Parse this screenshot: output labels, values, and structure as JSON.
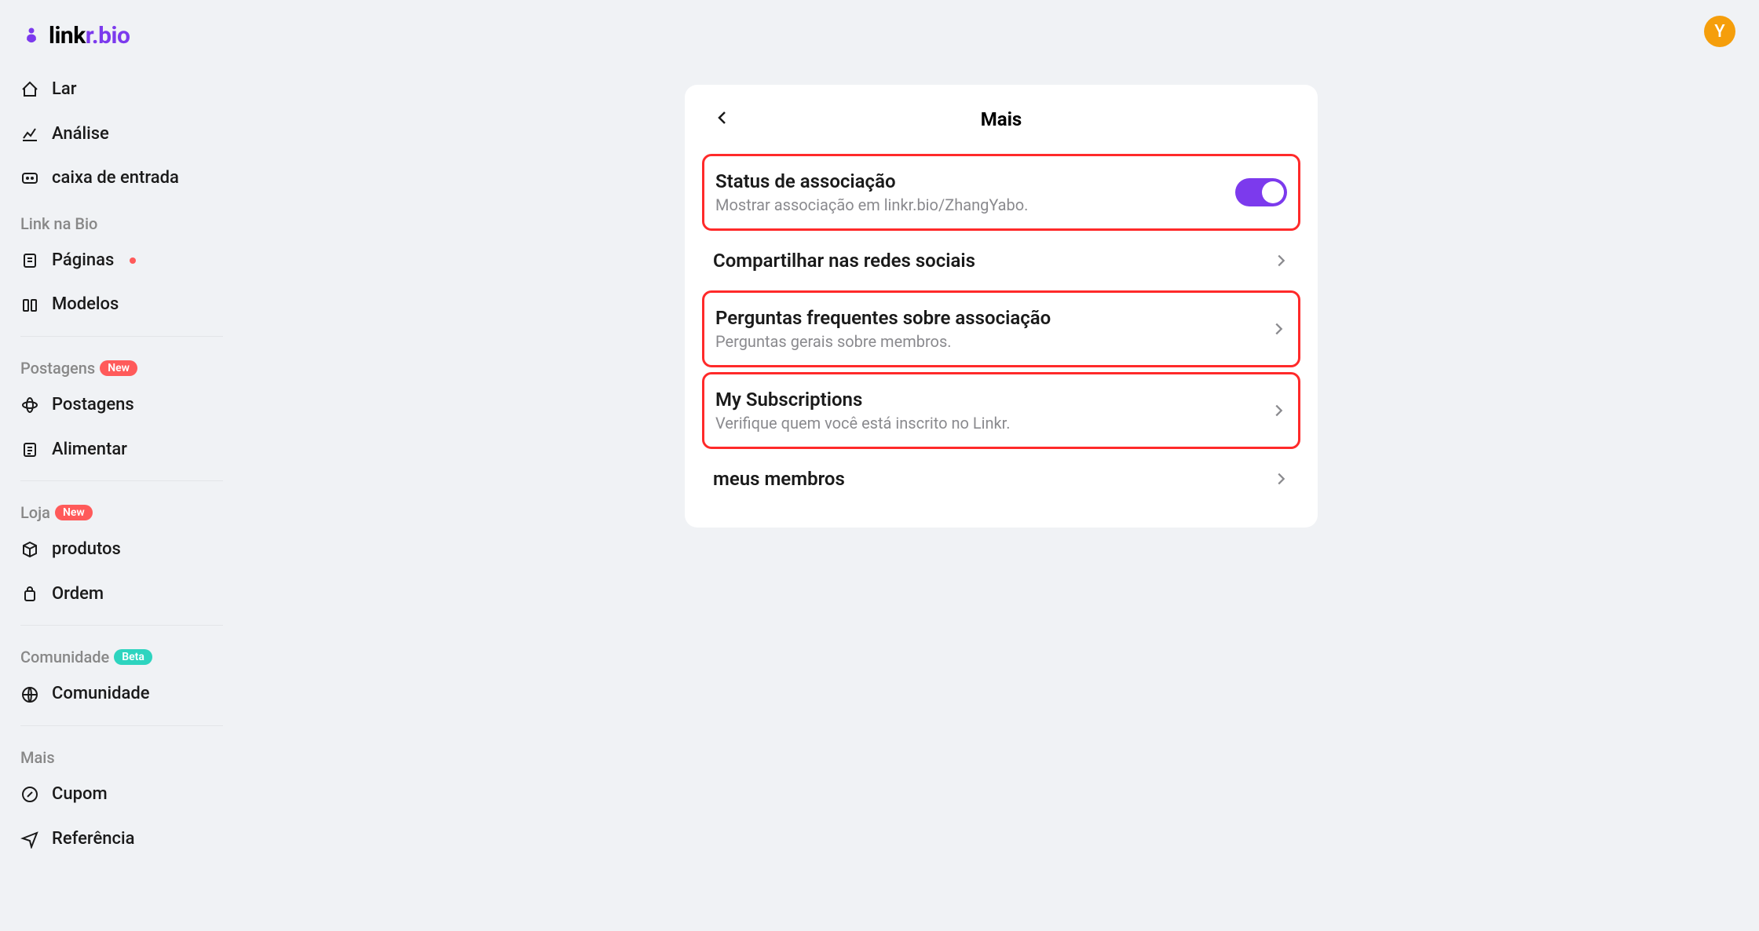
{
  "brand": {
    "name": "link",
    "accent": "r.bio"
  },
  "avatar": {
    "letter": "Y"
  },
  "nav": {
    "lar": "Lar",
    "analise": "Análise",
    "inbox": "caixa de entrada"
  },
  "sections": {
    "linknabio": {
      "label": "Link na Bio"
    },
    "postagens": {
      "label": "Postagens",
      "badge": "New"
    },
    "loja": {
      "label": "Loja",
      "badge": "New"
    },
    "comunidade": {
      "label": "Comunidade",
      "badge": "Beta"
    },
    "mais": {
      "label": "Mais"
    }
  },
  "linknabio": {
    "paginas": "Páginas",
    "modelos": "Modelos"
  },
  "postagens": {
    "postagens": "Postagens",
    "alimentar": "Alimentar"
  },
  "loja": {
    "produtos": "produtos",
    "ordem": "Ordem"
  },
  "comunidade": {
    "comunidade": "Comunidade"
  },
  "mais": {
    "cupom": "Cupom",
    "referencia": "Referência"
  },
  "card": {
    "title": "Mais",
    "rows": {
      "status": {
        "title": "Status de associação",
        "sub": "Mostrar associação em linkr.bio/ZhangYabo."
      },
      "share": {
        "title": "Compartilhar nas redes sociais"
      },
      "faq": {
        "title": "Perguntas frequentes sobre associação",
        "sub": "Perguntas gerais sobre membros."
      },
      "subs": {
        "title": "My Subscriptions",
        "sub": "Verifique quem você está inscrito no Linkr."
      },
      "members": {
        "title": "meus membros"
      }
    }
  }
}
